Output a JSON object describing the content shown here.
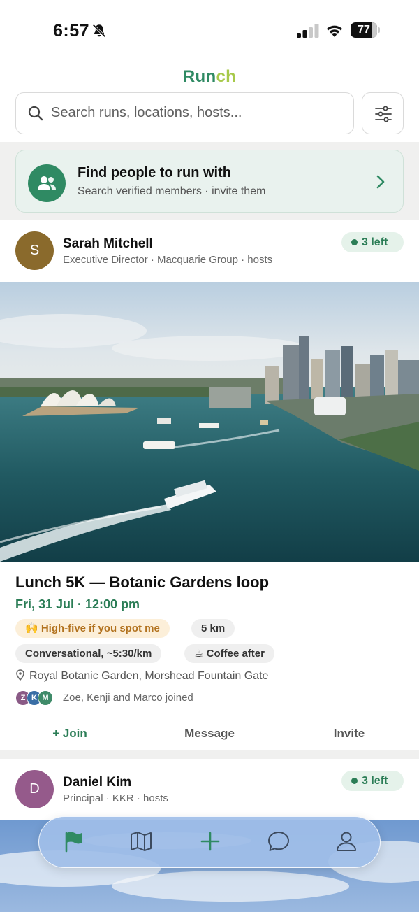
{
  "status_bar": {
    "time": "6:57",
    "battery": "77"
  },
  "app": {
    "logo_part1": "Run",
    "logo_part2": "ch"
  },
  "search": {
    "placeholder": "Search runs, locations, hosts..."
  },
  "find_people": {
    "title": "Find people to run with",
    "subtitle": "Search verified members · invite them"
  },
  "posts": [
    {
      "host_initial": "S",
      "host_name": "Sarah Mitchell",
      "host_subtitle": "Executive Director · Macquarie Group · hosts",
      "spots_left": "3 left",
      "title": "Lunch 5K — Botanic Gardens loop",
      "datetime": "Fri, 31 Jul · 12:00 pm",
      "tags": [
        "🙌 High-five if you spot me",
        "5 km",
        "Conversational, ~5:30/km",
        "☕ Coffee after"
      ],
      "location": "Royal Botanic Garden, Morshead Fountain Gate",
      "joined_initials": [
        "Z",
        "K",
        "M"
      ],
      "joined_text": "Zoe, Kenji and Marco joined",
      "actions": {
        "join": "+ Join",
        "message": "Message",
        "invite": "Invite"
      }
    },
    {
      "host_initial": "D",
      "host_name": "Daniel Kim",
      "host_subtitle": "Principal · KKR · hosts",
      "spots_left": "3 left"
    }
  ],
  "bottom_nav": [
    "flag-icon",
    "map-icon",
    "plus-icon",
    "chat-icon",
    "profile-icon"
  ],
  "colors": {
    "brand_green": "#2f8a63",
    "brand_lime": "#a7c94a",
    "accent_green": "#2b7d56"
  }
}
